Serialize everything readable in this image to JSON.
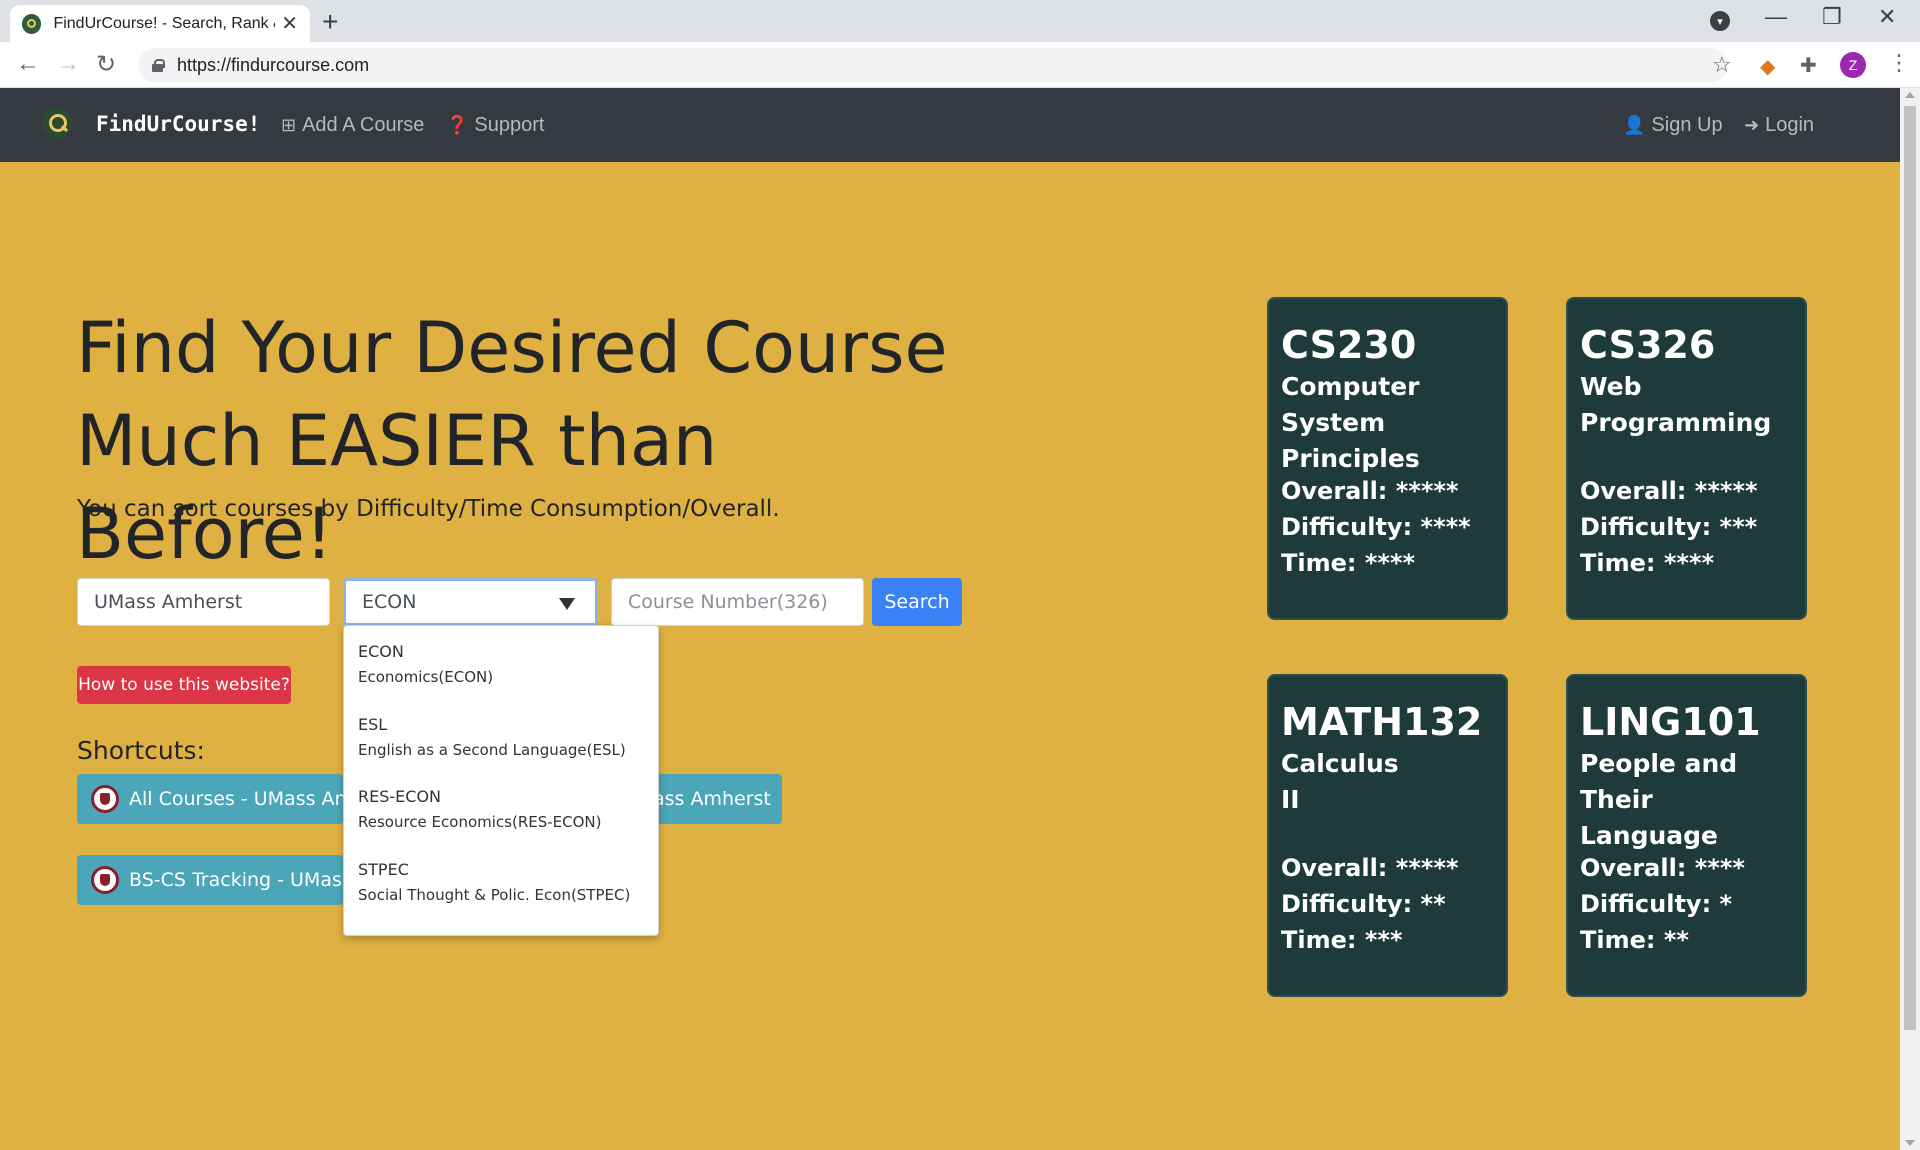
{
  "browser": {
    "tab_title": "FindUrCourse! - Search, Rank & Get Details",
    "url": "https://findurcourse.com",
    "profile_initial": "Z"
  },
  "navbar": {
    "brand": "FindUrCourse!",
    "add_course": "Add A Course",
    "support": "Support",
    "sign_up": "Sign Up",
    "login": "Login"
  },
  "hero": {
    "title_line1": "Find Your Desired Course",
    "title_line2": "Much EASIER than Before!",
    "subtitle": "You can sort courses by Difficulty/Time Consumption/Overall."
  },
  "search": {
    "school_value": "UMass Amherst",
    "subject_value": "ECON",
    "course_number_placeholder": "Course Number(326)",
    "button_label": "Search"
  },
  "dropdown": {
    "options": [
      {
        "code": "ECON",
        "name": "Economics(ECON)"
      },
      {
        "code": "ESL",
        "name": "English as a Second Language(ESL)"
      },
      {
        "code": "RES-ECON",
        "name": "Resource Economics(RES-ECON)"
      },
      {
        "code": "STPEC",
        "name": "Social Thought & Polic. Econ(STPEC)"
      }
    ]
  },
  "help_button": "How to use this website?",
  "shortcuts": {
    "label": "Shortcuts:",
    "items": [
      {
        "label": "All Courses - UMass Amherst"
      },
      {
        "label": "ass Amherst"
      },
      {
        "label": "BS-CS Tracking - UMass Amherst"
      }
    ]
  },
  "cards": [
    {
      "code": "CS230",
      "name_line1": "Computer System",
      "name_line2": "Principles",
      "overall": "Overall: *****",
      "difficulty": "Difficulty: ****",
      "time": "Time: ****"
    },
    {
      "code": "CS326",
      "name_line1": "Web",
      "name_line2": "Programming",
      "overall": "Overall: *****",
      "difficulty": "Difficulty: ***",
      "time": "Time: ****"
    },
    {
      "code": "MATH132",
      "name_line1": "Calculus",
      "name_line2": "II",
      "overall": "Overall: *****",
      "difficulty": "Difficulty: **",
      "time": "Time: ***"
    },
    {
      "code": "LING101",
      "name_line1": "People and",
      "name_line2": "Their Language",
      "overall": "Overall: ****",
      "difficulty": "Difficulty: *",
      "time": "Time: **"
    }
  ],
  "colors": {
    "page_background": "#dfb042",
    "navbar": "#343a40",
    "card": "#1e3a3a",
    "search_button": "#3b82f6",
    "help_button": "#dc3545",
    "shortcut_button": "#4aa6b8"
  }
}
